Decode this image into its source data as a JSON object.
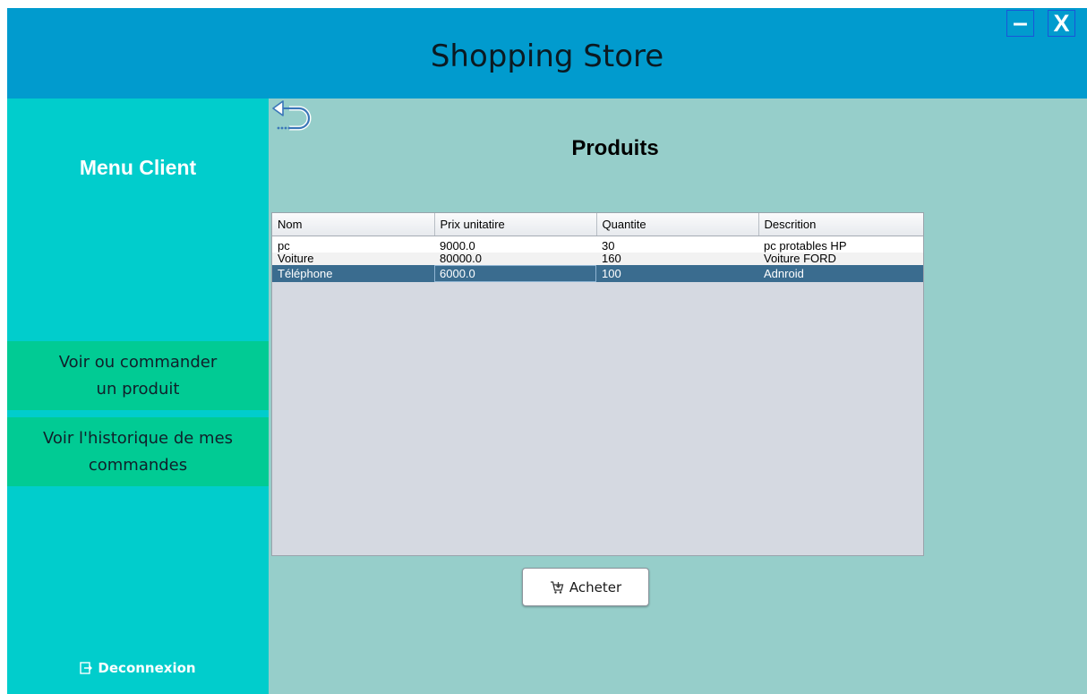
{
  "window": {
    "title": "Shopping Store",
    "minimize_label": "–",
    "close_label": "X"
  },
  "sidebar": {
    "title": "Menu Client",
    "items": [
      {
        "label": "Voir ou commander\nun produit"
      },
      {
        "label": "Voir l'historique de mes\ncommandes"
      }
    ],
    "logout_label": "Deconnexion"
  },
  "main": {
    "title": "Produits",
    "table": {
      "columns": [
        "Nom",
        "Prix unitatire",
        "Quantite",
        "Descrition"
      ],
      "rows": [
        [
          "pc",
          "9000.0",
          "30",
          "pc protables HP"
        ],
        [
          "Voiture",
          "80000.0",
          "160",
          " Voiture FORD"
        ],
        [
          "Téléphone",
          "6000.0",
          "100",
          " Adnroid"
        ]
      ],
      "selected_row": 2
    },
    "buy_label": "Acheter"
  },
  "colors": {
    "header": "#019bce",
    "sidebar": "#01cdcc",
    "menu_button": "#01cb94",
    "content": "#96ceca",
    "selection": "#3a6c8f"
  }
}
